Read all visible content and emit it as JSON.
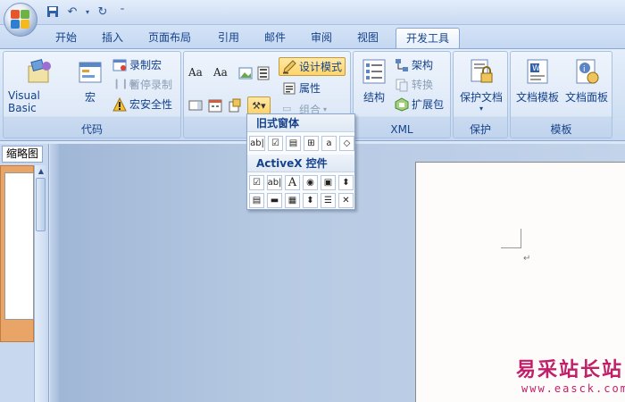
{
  "tabs": [
    "开始",
    "插入",
    "页面布局",
    "引用",
    "邮件",
    "审阅",
    "视图",
    "开发工具"
  ],
  "active_tab": "开发工具",
  "ribbon": {
    "code_group": {
      "label": "代码",
      "visual_basic": "Visual Basic",
      "macro": "宏",
      "record_macro": "录制宏",
      "pause_recording": "暂停录制",
      "macro_security": "宏安全性"
    },
    "controls_group": {
      "design_mode": "设计模式",
      "properties": "属性",
      "group": "组合",
      "label": ""
    },
    "xml_group": {
      "label": "XML",
      "structure": "结构",
      "schema": "架构",
      "transform": "转换",
      "expansion_pack": "扩展包"
    },
    "protect_group": {
      "label": "保护",
      "protect_document": "保护文档"
    },
    "templates_group": {
      "label": "模板",
      "document_template": "文档模板",
      "document_panel": "文档面板"
    }
  },
  "dropdown": {
    "legacy_header": "旧式窗体",
    "legacy_controls": [
      "ab|",
      "☑",
      "▤",
      "⊞",
      "a",
      "◇"
    ],
    "activex_header": "ActiveX 控件",
    "activex_row1": [
      "☑",
      "ab|",
      "A",
      "◉",
      "▣",
      "⬍"
    ],
    "activex_row2": [
      "▤",
      "▬",
      "▦",
      "⬍",
      "☰",
      "✕"
    ]
  },
  "thumbnail_pane": {
    "tab_label": "缩略图"
  },
  "document": {
    "paragraph_mark": "↵"
  },
  "watermark": {
    "text_cn": "易采站长站",
    "url": "www.easck.com"
  },
  "colors": {
    "ribbon_text": "#15428b",
    "watermark": "#c0206a"
  }
}
